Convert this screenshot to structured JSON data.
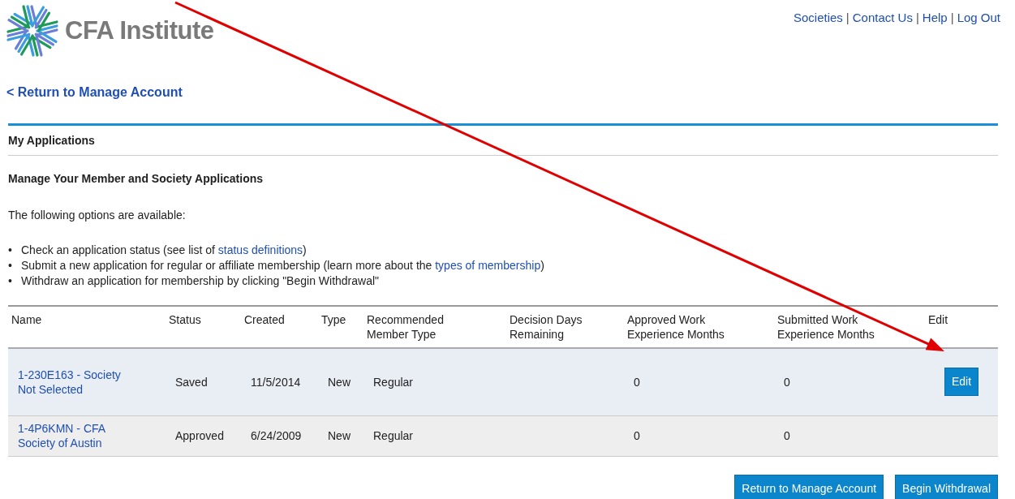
{
  "logo": {
    "text": "CFA Institute"
  },
  "top_links": {
    "separator": "|",
    "items": [
      "Societies",
      "Contact Us",
      "Help",
      "Log Out"
    ]
  },
  "back_link": "< Return to Manage Account",
  "section_title": "My Applications",
  "heading": "Manage Your Member and Society Applications",
  "intro": "The following options are available:",
  "bullets": [
    {
      "marker": "•",
      "before": "Check an application status (see list of ",
      "link": "status definitions",
      "after": ")"
    },
    {
      "marker": "•",
      "before": "Submit a new application for regular or affiliate membership (learn more about the ",
      "link": "types of membership",
      "after": ")"
    },
    {
      "marker": "•",
      "before": "Withdraw an application for membership by clicking \"Begin Withdrawal\""
    }
  ],
  "table": {
    "columns": [
      "Name",
      "Status",
      "Created",
      "Type",
      "Recommended Member Type",
      "Decision Days Remaining",
      "Approved Work Experience Months",
      "Submitted Work Experience Months",
      "Edit"
    ],
    "rows": [
      {
        "name": "1-230E163 - Society Not Selected",
        "status": "Saved",
        "created": "11/5/2014",
        "type": "New",
        "recommended": "Regular",
        "approved_months": "0",
        "submitted_months": "0",
        "edit": "Edit",
        "selected": true
      },
      {
        "name": "1-4P6KMN - CFA Society of Austin",
        "status": "Approved",
        "created": "6/24/2009",
        "type": "New",
        "recommended": "Regular",
        "approved_months": "0",
        "submitted_months": "0",
        "selected": false
      }
    ]
  },
  "buttons": [
    "Return to Manage Account",
    "Begin Withdrawal"
  ],
  "annotation": {
    "kind": "arrow"
  }
}
